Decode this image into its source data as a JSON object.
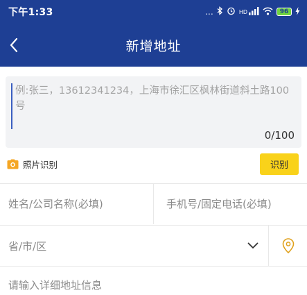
{
  "status_bar": {
    "time": "下午1:33",
    "signal_text": "…",
    "network": "HD",
    "battery": "96"
  },
  "header": {
    "title": "新增地址"
  },
  "paste_area": {
    "placeholder": "例:张三，13612341234，上海市徐汇区枫林街道斜土路100号",
    "value": "",
    "char_count": "0/100"
  },
  "photo_recognize": {
    "label": "照片识别",
    "button_label": "识别"
  },
  "form": {
    "name_placeholder": "姓名/公司名称(必填)",
    "phone_placeholder": "手机号/固定电话(必填)",
    "region_placeholder": "省/市/区",
    "detail_placeholder": "请输入详细地址信息"
  },
  "colors": {
    "brand": "#1e3f94",
    "accent": "#f9d21a",
    "location_icon": "#e0a11c"
  }
}
